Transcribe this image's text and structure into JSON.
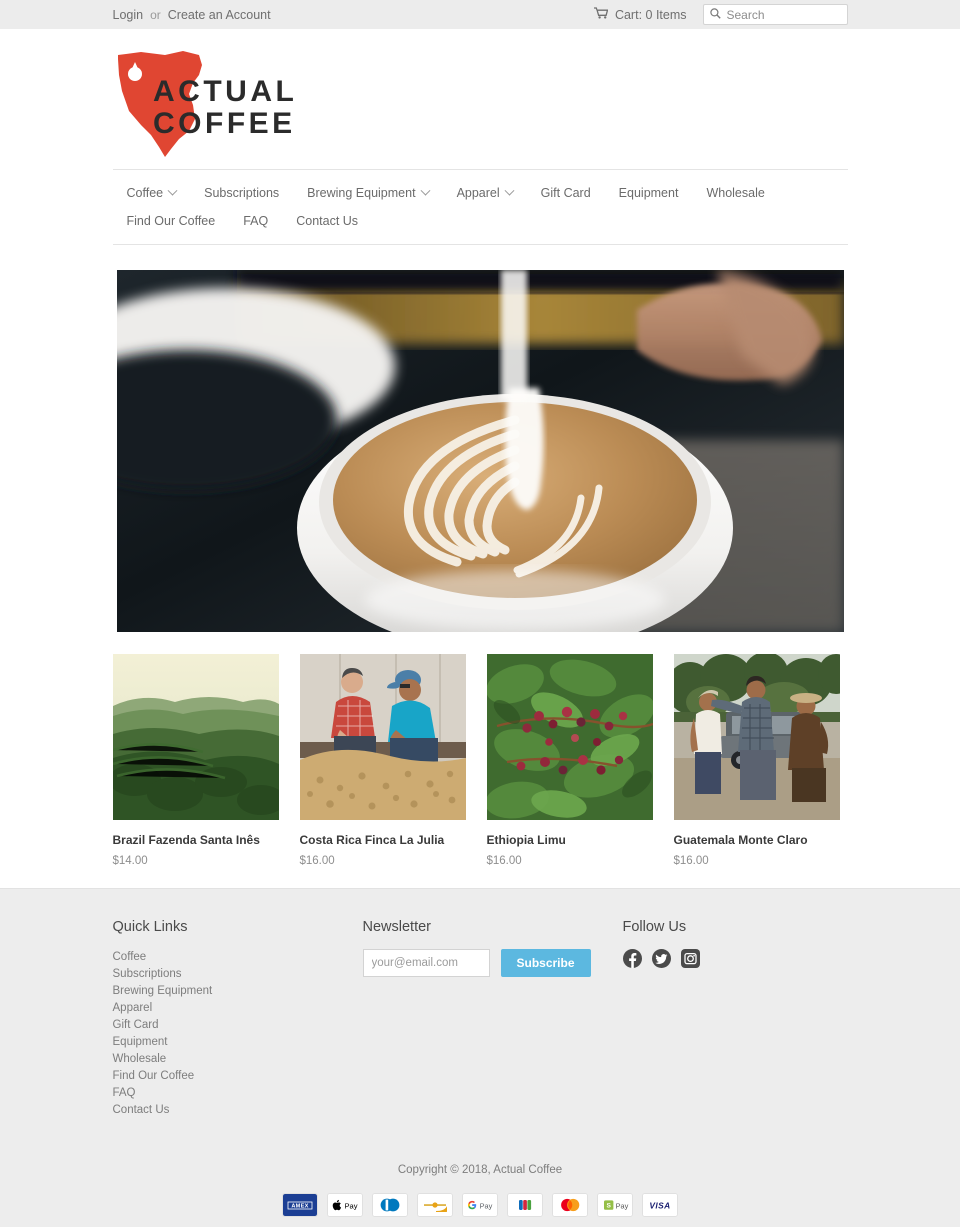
{
  "topbar": {
    "login_label": "Login",
    "separator": "or",
    "create_account_label": "Create an Account",
    "cart_label": "Cart: 0 Items",
    "cart_icon": "shopping-cart-icon",
    "search_icon": "search-icon",
    "search_value": "",
    "search_placeholder": "Search"
  },
  "brand": {
    "name_line1": "ACTUAL",
    "name_line2": "COFFEE",
    "logo_shape": "ohio-state-outline",
    "logo_color": "#e04632"
  },
  "nav": {
    "items": [
      {
        "label": "Coffee",
        "has_dropdown": true
      },
      {
        "label": "Subscriptions",
        "has_dropdown": false
      },
      {
        "label": "Brewing Equipment",
        "has_dropdown": true
      },
      {
        "label": "Apparel",
        "has_dropdown": true
      },
      {
        "label": "Gift Card",
        "has_dropdown": false
      },
      {
        "label": "Equipment",
        "has_dropdown": false
      },
      {
        "label": "Wholesale",
        "has_dropdown": false
      },
      {
        "label": "Find Our Coffee",
        "has_dropdown": false
      },
      {
        "label": "FAQ",
        "has_dropdown": false
      },
      {
        "label": "Contact Us",
        "has_dropdown": false
      }
    ]
  },
  "hero": {
    "alt": "Barista pouring steamed milk latte art into a white cup"
  },
  "products": [
    {
      "title": "Brazil Fazenda Santa Inês",
      "price": "$14.00",
      "image_alt": "Aerial view of green coffee farm hills"
    },
    {
      "title": "Costa Rica Finca La Julia",
      "price": "$16.00",
      "image_alt": "Two men inspecting drying coffee beans"
    },
    {
      "title": "Ethiopia Limu",
      "price": "$16.00",
      "image_alt": "Coffee cherries ripening on the branch"
    },
    {
      "title": "Guatemala Monte Claro",
      "price": "$16.00",
      "image_alt": "Three farmers talking beside a pickup truck"
    }
  ],
  "footer": {
    "quick_links": {
      "heading": "Quick Links",
      "items": [
        "Coffee",
        "Subscriptions",
        "Brewing Equipment",
        "Apparel",
        "Gift Card",
        "Equipment",
        "Wholesale",
        "Find Our Coffee",
        "FAQ",
        "Contact Us"
      ]
    },
    "newsletter": {
      "heading": "Newsletter",
      "email_value": "",
      "email_placeholder": "your@email.com",
      "subscribe_label": "Subscribe",
      "subscribe_color": "#5cb8e0"
    },
    "follow": {
      "heading": "Follow Us",
      "icons": [
        "facebook-icon",
        "twitter-icon",
        "instagram-icon"
      ]
    },
    "copyright": "Copyright © 2018, Actual Coffee",
    "payments": [
      {
        "name": "amex-icon",
        "label": "AMEX"
      },
      {
        "name": "apple-pay-icon",
        "label": "Pay"
      },
      {
        "name": "diners-club-icon",
        "label": ""
      },
      {
        "name": "discover-icon",
        "label": ""
      },
      {
        "name": "google-pay-icon",
        "label": "Pay"
      },
      {
        "name": "jcb-icon",
        "label": ""
      },
      {
        "name": "mastercard-icon",
        "label": ""
      },
      {
        "name": "shop-pay-icon",
        "label": "Pay"
      },
      {
        "name": "visa-icon",
        "label": "VISA"
      }
    ]
  }
}
